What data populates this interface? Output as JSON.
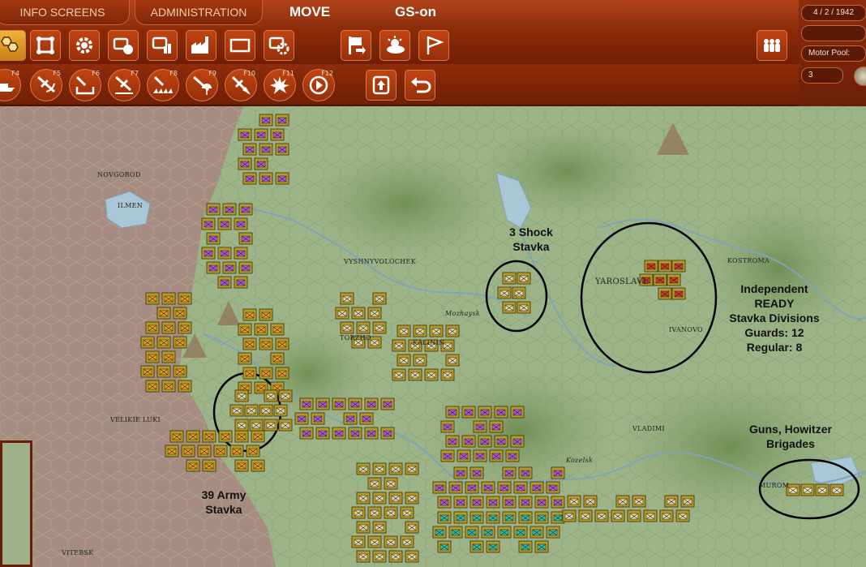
{
  "header": {
    "tabs": [
      {
        "label": "INFO SCREENS"
      },
      {
        "label": "ADMINISTRATION"
      }
    ],
    "mode": "MOVE",
    "game_state": "GS-on"
  },
  "side_panel": {
    "date": "4 / 2 / 1942",
    "motor_pool_label": "Motor Pool:",
    "motor_pool_value": "3"
  },
  "toolbar": {
    "function_keys": [
      "F4",
      "F5",
      "F6",
      "F7",
      "F8",
      "F9",
      "F10",
      "F11",
      "F12"
    ],
    "icons_row1": [
      "hex-stack-icon",
      "unit-symbol-icon",
      "gear-icon",
      "shape-node-icon",
      "bar-symbol-icon",
      "factory-icon",
      "rectangle-icon",
      "target-gear-icon",
      "flag-arrow-icon",
      "weather-icon",
      "pennant-icon",
      "troops-icon"
    ],
    "icons_row2": [
      "ship-icon",
      "fighter-icon",
      "bomber-icon",
      "naval-bomber-icon",
      "recon-icon",
      "paradrop-icon",
      "air-attack-icon",
      "explosion-icon",
      "next-unit-icon",
      "upload-icon",
      "undo-icon"
    ]
  },
  "map": {
    "cities": [
      "NOVGOROD",
      "ILMEN",
      "VYSHNYVOLOCHEK",
      "TORZHO",
      "KALININ",
      "YAROSLAVL",
      "KOSTROMA",
      "IVANOVO",
      "VELIKIE LUKI",
      "VLADIMI",
      "MUROM",
      "VITEBSK",
      "Mozhaysk",
      "Kozelsk"
    ],
    "annotations": {
      "shock": [
        "3 Shock",
        "Stavka"
      ],
      "independent": [
        "Independent",
        "READY",
        "Stavka Divisions",
        "Guards: 12",
        "Regular: 8"
      ],
      "guns": [
        "Guns, Howitzer",
        "Brigades"
      ],
      "army39": [
        "39 Army",
        "Stavka"
      ]
    },
    "unit_colors": {
      "rifle": "#e6dcb0",
      "guards": "#f0a020",
      "tank": "#b05ad8",
      "cavalry": "#2fbfa8",
      "stavka": "#d63a2a",
      "hq": "#f2e9c6",
      "frame": "#b49a26"
    }
  }
}
